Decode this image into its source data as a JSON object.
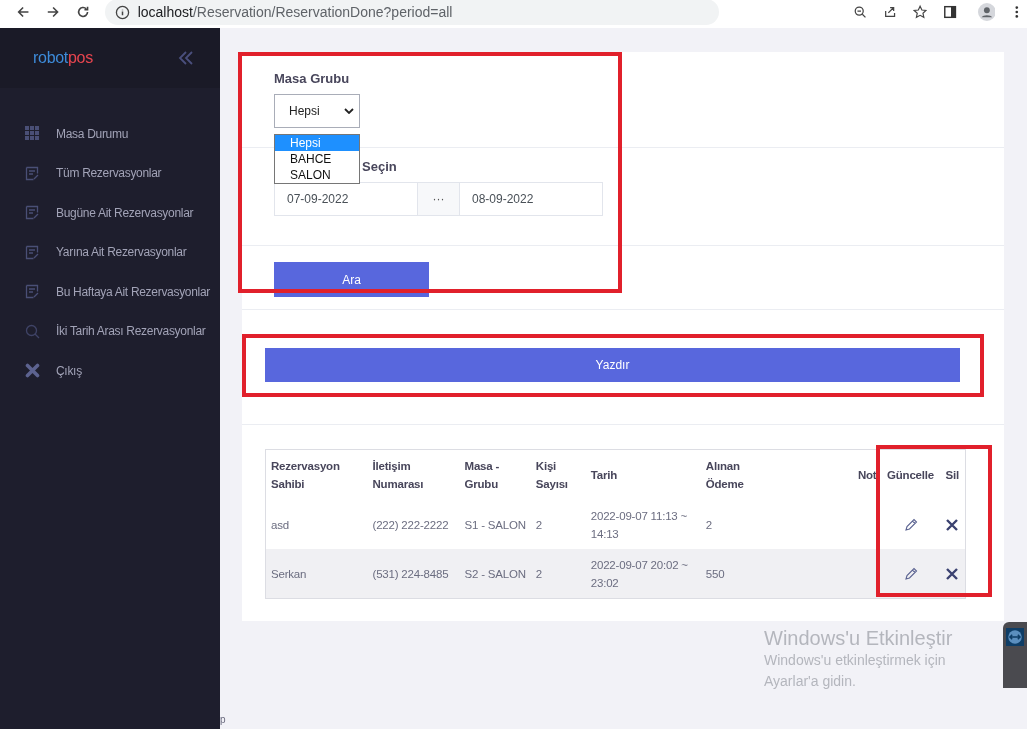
{
  "browser": {
    "url_host": "localhost",
    "url_path": "/Reservation/ReservationDone?period=all"
  },
  "sidebar": {
    "logo_left": "robot",
    "logo_right": "pos",
    "items": [
      {
        "label": "Masa Durumu",
        "kind": "grid"
      },
      {
        "label": "Tüm Rezervasyonlar",
        "kind": "list"
      },
      {
        "label": "Bugüne Ait Rezervasyonlar",
        "kind": "list"
      },
      {
        "label": "Yarına Ait Rezervasyonlar",
        "kind": "list"
      },
      {
        "label": "Bu Haftaya Ait Rezervasyonlar",
        "kind": "list"
      },
      {
        "label": "İki Tarih Arası Rezervasyonlar",
        "kind": "search"
      },
      {
        "label": "Çıkış",
        "kind": "exit"
      }
    ],
    "stray_text": "p"
  },
  "filter": {
    "group_label": "Masa Grubu",
    "group_value": "Hepsi",
    "group_options": [
      {
        "label": "Hepsi",
        "selected": true
      },
      {
        "label": "BAHCE",
        "selected": false
      },
      {
        "label": "SALON",
        "selected": false
      }
    ],
    "date_label": "Seçin",
    "date_from": "07-09-2022",
    "date_separator": "···",
    "date_to": "08-09-2022",
    "search_button": "Ara"
  },
  "print_button": "Yazdır",
  "table": {
    "columns": [
      "Rezervasyon Sahibi",
      "İletişim Numarası",
      "Masa - Grubu",
      "Kişi Sayısı",
      "Tarih",
      "Alınan Ödeme",
      "Not",
      "Güncelle",
      "Sil"
    ],
    "rows": [
      {
        "cells": [
          "asd",
          "(222) 222-2222",
          "S1 - SALON",
          "2",
          "2022-09-07 11:13 ~ 14:13",
          "2",
          ""
        ]
      },
      {
        "cells": [
          "Serkan",
          "(531) 224-8485",
          "S2 - SALON",
          "2",
          "2022-09-07 20:02 ~ 23:02",
          "550",
          ""
        ]
      }
    ]
  },
  "windows_notice": {
    "title": "Windows'u Etkinleştir",
    "text": "Windows'u etkinleştirmek için Ayarlar'a gidin."
  }
}
